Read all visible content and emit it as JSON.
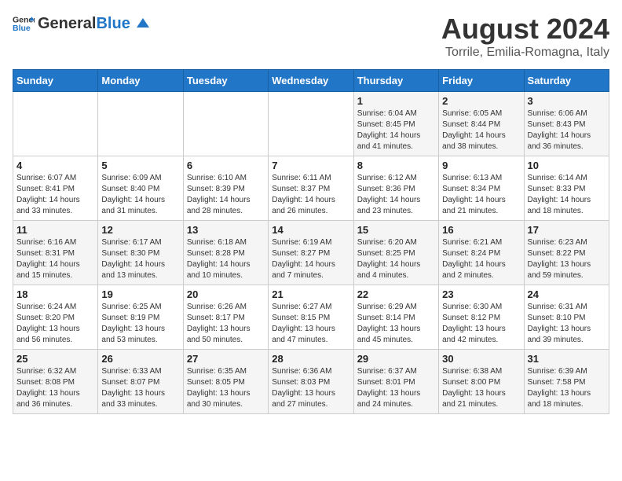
{
  "logo": {
    "general": "General",
    "blue": "Blue"
  },
  "title": "August 2024",
  "subtitle": "Torrile, Emilia-Romagna, Italy",
  "days_of_week": [
    "Sunday",
    "Monday",
    "Tuesday",
    "Wednesday",
    "Thursday",
    "Friday",
    "Saturday"
  ],
  "weeks": [
    [
      {
        "day": "",
        "sunrise": "",
        "sunset": "",
        "daylight": ""
      },
      {
        "day": "",
        "sunrise": "",
        "sunset": "",
        "daylight": ""
      },
      {
        "day": "",
        "sunrise": "",
        "sunset": "",
        "daylight": ""
      },
      {
        "day": "",
        "sunrise": "",
        "sunset": "",
        "daylight": ""
      },
      {
        "day": "1",
        "sunrise": "Sunrise: 6:04 AM",
        "sunset": "Sunset: 8:45 PM",
        "daylight": "Daylight: 14 hours and 41 minutes."
      },
      {
        "day": "2",
        "sunrise": "Sunrise: 6:05 AM",
        "sunset": "Sunset: 8:44 PM",
        "daylight": "Daylight: 14 hours and 38 minutes."
      },
      {
        "day": "3",
        "sunrise": "Sunrise: 6:06 AM",
        "sunset": "Sunset: 8:43 PM",
        "daylight": "Daylight: 14 hours and 36 minutes."
      }
    ],
    [
      {
        "day": "4",
        "sunrise": "Sunrise: 6:07 AM",
        "sunset": "Sunset: 8:41 PM",
        "daylight": "Daylight: 14 hours and 33 minutes."
      },
      {
        "day": "5",
        "sunrise": "Sunrise: 6:09 AM",
        "sunset": "Sunset: 8:40 PM",
        "daylight": "Daylight: 14 hours and 31 minutes."
      },
      {
        "day": "6",
        "sunrise": "Sunrise: 6:10 AM",
        "sunset": "Sunset: 8:39 PM",
        "daylight": "Daylight: 14 hours and 28 minutes."
      },
      {
        "day": "7",
        "sunrise": "Sunrise: 6:11 AM",
        "sunset": "Sunset: 8:37 PM",
        "daylight": "Daylight: 14 hours and 26 minutes."
      },
      {
        "day": "8",
        "sunrise": "Sunrise: 6:12 AM",
        "sunset": "Sunset: 8:36 PM",
        "daylight": "Daylight: 14 hours and 23 minutes."
      },
      {
        "day": "9",
        "sunrise": "Sunrise: 6:13 AM",
        "sunset": "Sunset: 8:34 PM",
        "daylight": "Daylight: 14 hours and 21 minutes."
      },
      {
        "day": "10",
        "sunrise": "Sunrise: 6:14 AM",
        "sunset": "Sunset: 8:33 PM",
        "daylight": "Daylight: 14 hours and 18 minutes."
      }
    ],
    [
      {
        "day": "11",
        "sunrise": "Sunrise: 6:16 AM",
        "sunset": "Sunset: 8:31 PM",
        "daylight": "Daylight: 14 hours and 15 minutes."
      },
      {
        "day": "12",
        "sunrise": "Sunrise: 6:17 AM",
        "sunset": "Sunset: 8:30 PM",
        "daylight": "Daylight: 14 hours and 13 minutes."
      },
      {
        "day": "13",
        "sunrise": "Sunrise: 6:18 AM",
        "sunset": "Sunset: 8:28 PM",
        "daylight": "Daylight: 14 hours and 10 minutes."
      },
      {
        "day": "14",
        "sunrise": "Sunrise: 6:19 AM",
        "sunset": "Sunset: 8:27 PM",
        "daylight": "Daylight: 14 hours and 7 minutes."
      },
      {
        "day": "15",
        "sunrise": "Sunrise: 6:20 AM",
        "sunset": "Sunset: 8:25 PM",
        "daylight": "Daylight: 14 hours and 4 minutes."
      },
      {
        "day": "16",
        "sunrise": "Sunrise: 6:21 AM",
        "sunset": "Sunset: 8:24 PM",
        "daylight": "Daylight: 14 hours and 2 minutes."
      },
      {
        "day": "17",
        "sunrise": "Sunrise: 6:23 AM",
        "sunset": "Sunset: 8:22 PM",
        "daylight": "Daylight: 13 hours and 59 minutes."
      }
    ],
    [
      {
        "day": "18",
        "sunrise": "Sunrise: 6:24 AM",
        "sunset": "Sunset: 8:20 PM",
        "daylight": "Daylight: 13 hours and 56 minutes."
      },
      {
        "day": "19",
        "sunrise": "Sunrise: 6:25 AM",
        "sunset": "Sunset: 8:19 PM",
        "daylight": "Daylight: 13 hours and 53 minutes."
      },
      {
        "day": "20",
        "sunrise": "Sunrise: 6:26 AM",
        "sunset": "Sunset: 8:17 PM",
        "daylight": "Daylight: 13 hours and 50 minutes."
      },
      {
        "day": "21",
        "sunrise": "Sunrise: 6:27 AM",
        "sunset": "Sunset: 8:15 PM",
        "daylight": "Daylight: 13 hours and 47 minutes."
      },
      {
        "day": "22",
        "sunrise": "Sunrise: 6:29 AM",
        "sunset": "Sunset: 8:14 PM",
        "daylight": "Daylight: 13 hours and 45 minutes."
      },
      {
        "day": "23",
        "sunrise": "Sunrise: 6:30 AM",
        "sunset": "Sunset: 8:12 PM",
        "daylight": "Daylight: 13 hours and 42 minutes."
      },
      {
        "day": "24",
        "sunrise": "Sunrise: 6:31 AM",
        "sunset": "Sunset: 8:10 PM",
        "daylight": "Daylight: 13 hours and 39 minutes."
      }
    ],
    [
      {
        "day": "25",
        "sunrise": "Sunrise: 6:32 AM",
        "sunset": "Sunset: 8:08 PM",
        "daylight": "Daylight: 13 hours and 36 minutes."
      },
      {
        "day": "26",
        "sunrise": "Sunrise: 6:33 AM",
        "sunset": "Sunset: 8:07 PM",
        "daylight": "Daylight: 13 hours and 33 minutes."
      },
      {
        "day": "27",
        "sunrise": "Sunrise: 6:35 AM",
        "sunset": "Sunset: 8:05 PM",
        "daylight": "Daylight: 13 hours and 30 minutes."
      },
      {
        "day": "28",
        "sunrise": "Sunrise: 6:36 AM",
        "sunset": "Sunset: 8:03 PM",
        "daylight": "Daylight: 13 hours and 27 minutes."
      },
      {
        "day": "29",
        "sunrise": "Sunrise: 6:37 AM",
        "sunset": "Sunset: 8:01 PM",
        "daylight": "Daylight: 13 hours and 24 minutes."
      },
      {
        "day": "30",
        "sunrise": "Sunrise: 6:38 AM",
        "sunset": "Sunset: 8:00 PM",
        "daylight": "Daylight: 13 hours and 21 minutes."
      },
      {
        "day": "31",
        "sunrise": "Sunrise: 6:39 AM",
        "sunset": "Sunset: 7:58 PM",
        "daylight": "Daylight: 13 hours and 18 minutes."
      }
    ]
  ]
}
